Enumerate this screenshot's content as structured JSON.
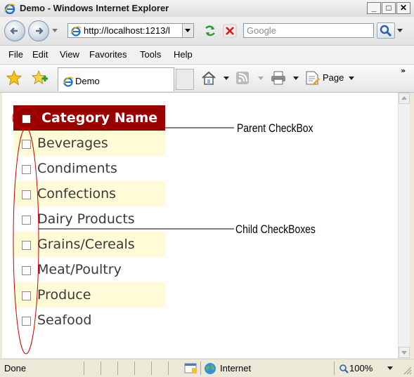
{
  "window": {
    "title": "Demo - Windows Internet Explorer"
  },
  "address": {
    "url": "http://localhost:1213/l"
  },
  "search": {
    "placeholder": "Google"
  },
  "menu": [
    "File",
    "Edit",
    "View",
    "Favorites",
    "Tools",
    "Help"
  ],
  "tab": {
    "label": "Demo"
  },
  "commandbar": {
    "page_label": "Page"
  },
  "grid": {
    "header": "Category Name",
    "rows": [
      "Beverages",
      "Condiments",
      "Confections",
      "Dairy Products",
      "Grains/Cereals",
      "Meat/Poultry",
      "Produce",
      "Seafood"
    ]
  },
  "annotations": {
    "parent": "Parent CheckBox",
    "child": "Child CheckBoxes"
  },
  "status": {
    "text": "Done",
    "zone": "Internet",
    "zoom": "100%"
  },
  "colors": {
    "header_bg": "#990000",
    "alt_row_bg": "#fffbd6",
    "annotation_ellipse": "#cc0000"
  }
}
